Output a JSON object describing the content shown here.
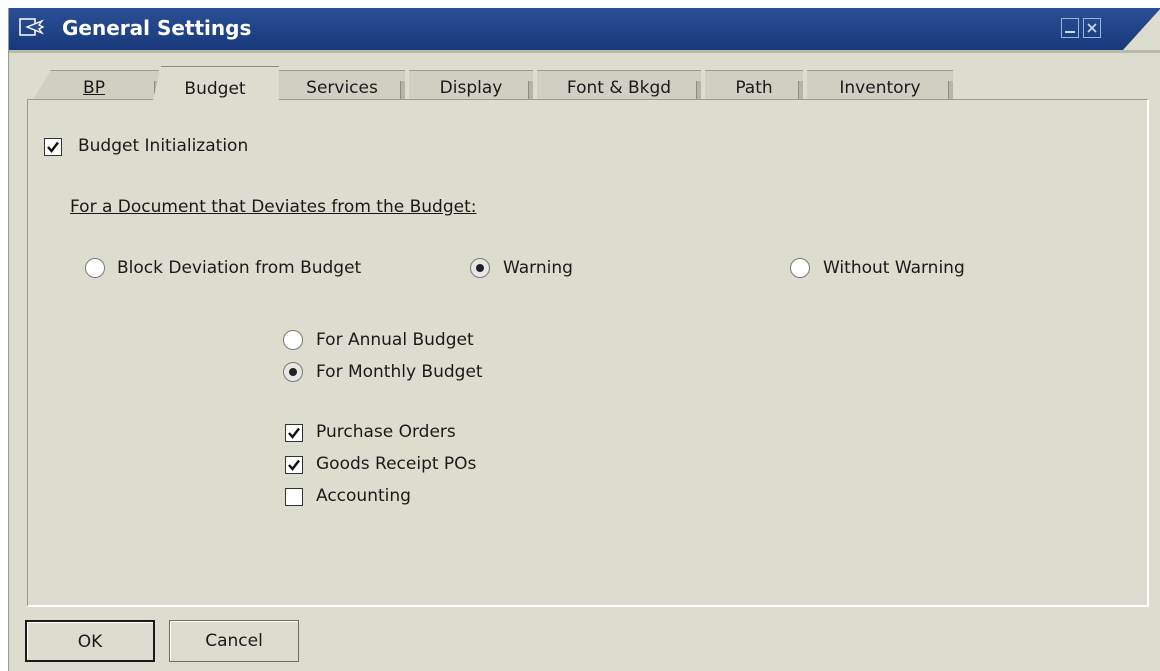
{
  "window": {
    "title": "General Settings"
  },
  "tabs": [
    {
      "label": "BP",
      "underline_index": 0
    },
    {
      "label": "Budget",
      "underline_index": 2
    },
    {
      "label": "Services",
      "underline_index": 0
    },
    {
      "label": "Display",
      "underline_index": 2
    },
    {
      "label": "Font & Bkgd",
      "underline_index": 1
    },
    {
      "label": "Path",
      "underline_index": 3
    },
    {
      "label": "Inventory",
      "underline_index": 1
    }
  ],
  "active_tab": "Budget",
  "budget": {
    "budget_initialization": {
      "label": "Budget Initialization",
      "checked": true
    },
    "section_heading": "For a Document that Deviates from the Budget:",
    "deviation_options": [
      {
        "label": "Block Deviation from Budget",
        "selected": false
      },
      {
        "label": "Warning",
        "selected": true
      },
      {
        "label": "Without Warning",
        "selected": false
      }
    ],
    "period_options": [
      {
        "label": "For Annual Budget",
        "selected": false
      },
      {
        "label": "For Monthly Budget",
        "selected": true
      }
    ],
    "document_types": [
      {
        "label": "Purchase Orders",
        "checked": true
      },
      {
        "label": "Goods Receipt POs",
        "checked": true
      },
      {
        "label": "Accounting",
        "checked": false
      }
    ]
  },
  "buttons": {
    "ok": "OK",
    "cancel": "Cancel"
  }
}
